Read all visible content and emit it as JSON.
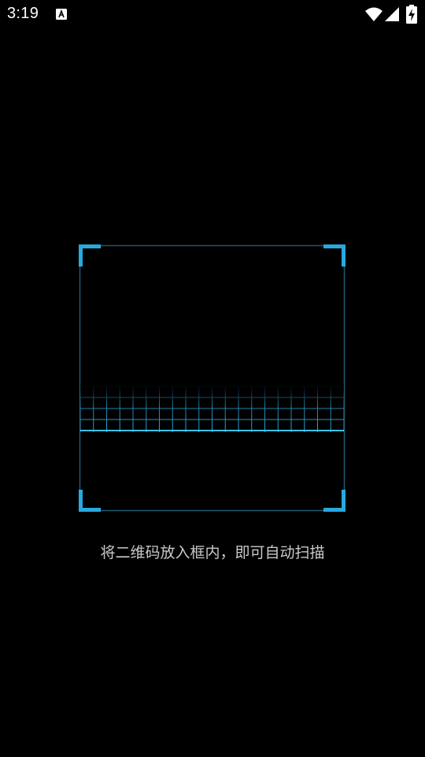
{
  "status_bar": {
    "time": "3:19",
    "notification_icon": "a-square-icon",
    "wifi_icon": "wifi-icon",
    "signal_icon": "cell-signal-icon",
    "battery_icon": "battery-charging-icon"
  },
  "scanner": {
    "accent_color": "#29a8dd",
    "frame_color": "#1f5a73"
  },
  "hint": {
    "text": "将二维码放入框内，即可自动扫描"
  }
}
